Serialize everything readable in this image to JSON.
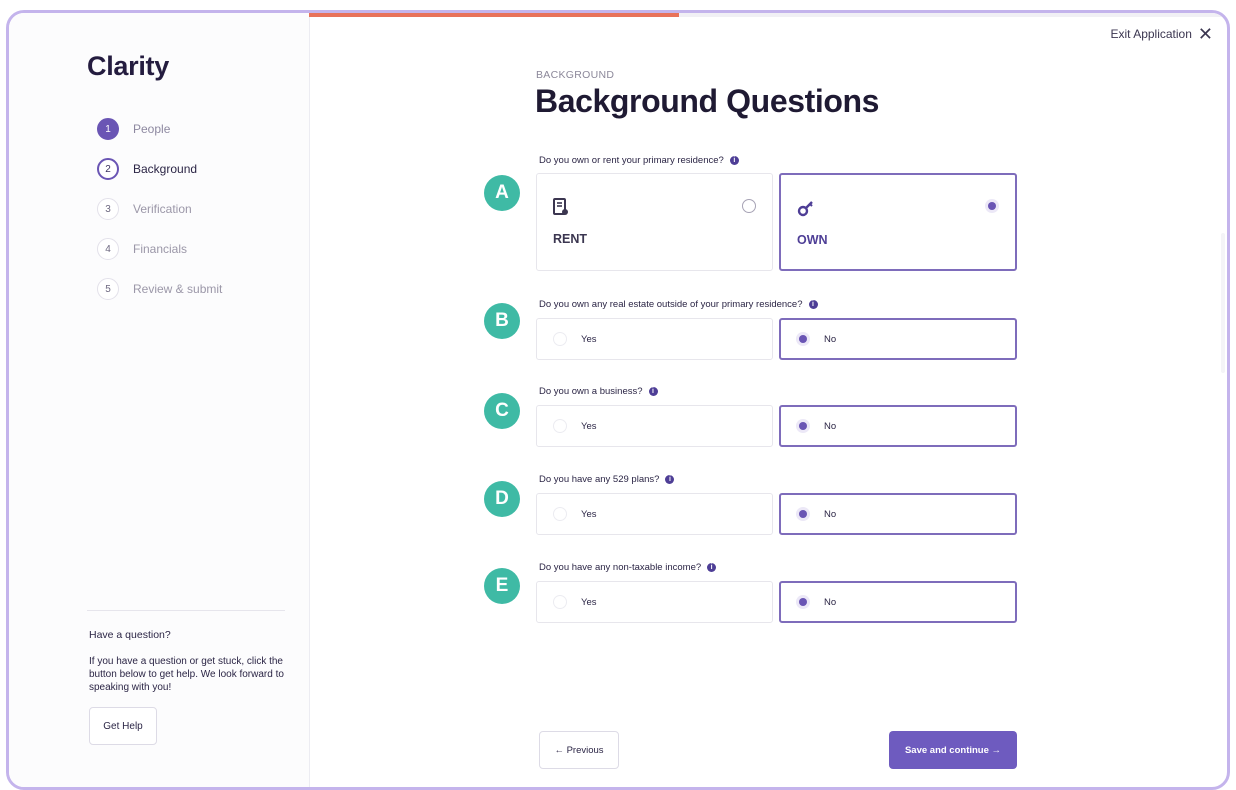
{
  "brand": "Clarity",
  "steps": [
    {
      "num": "1",
      "label": "People",
      "state": "done"
    },
    {
      "num": "2",
      "label": "Background",
      "state": "active"
    },
    {
      "num": "3",
      "label": "Verification",
      "state": "todo"
    },
    {
      "num": "4",
      "label": "Financials",
      "state": "todo"
    },
    {
      "num": "5",
      "label": "Review & submit",
      "state": "todo"
    }
  ],
  "help": {
    "title": "Have a question?",
    "text": "If you have a question or get stuck, click the button below to get help. We look forward to speaking with you!",
    "button": "Get Help"
  },
  "progress": 0.4,
  "exit_label": "Exit Application",
  "exit_icon": "close-icon",
  "eyebrow": "BACKGROUND",
  "heading": "Background Questions",
  "info_icon": "i",
  "questions": [
    {
      "badge": "A",
      "label": "Do you own or rent your primary residence?",
      "options": [
        "RENT",
        "OWN"
      ],
      "selected": "OWN",
      "option_icons": [
        "document-icon",
        "key-icon"
      ]
    },
    {
      "badge": "B",
      "label": "Do you own any real estate outside of your primary residence?",
      "options": [
        "Yes",
        "No"
      ],
      "selected": "No"
    },
    {
      "badge": "C",
      "label": "Do you own a business?",
      "options": [
        "Yes",
        "No"
      ],
      "selected": "No"
    },
    {
      "badge": "D",
      "label": "Do you have any 529 plans?",
      "options": [
        "Yes",
        "No"
      ],
      "selected": "No"
    },
    {
      "badge": "E",
      "label": "Do you have any non-taxable income?",
      "options": [
        "Yes",
        "No"
      ],
      "selected": "No"
    }
  ],
  "nav": {
    "previous": "← Previous",
    "next": "Save and continue →"
  },
  "colors": {
    "accent": "#6a55b4",
    "badge": "#3fbaa5",
    "progress": "#e8725a",
    "frame": "#c4b4ec"
  }
}
